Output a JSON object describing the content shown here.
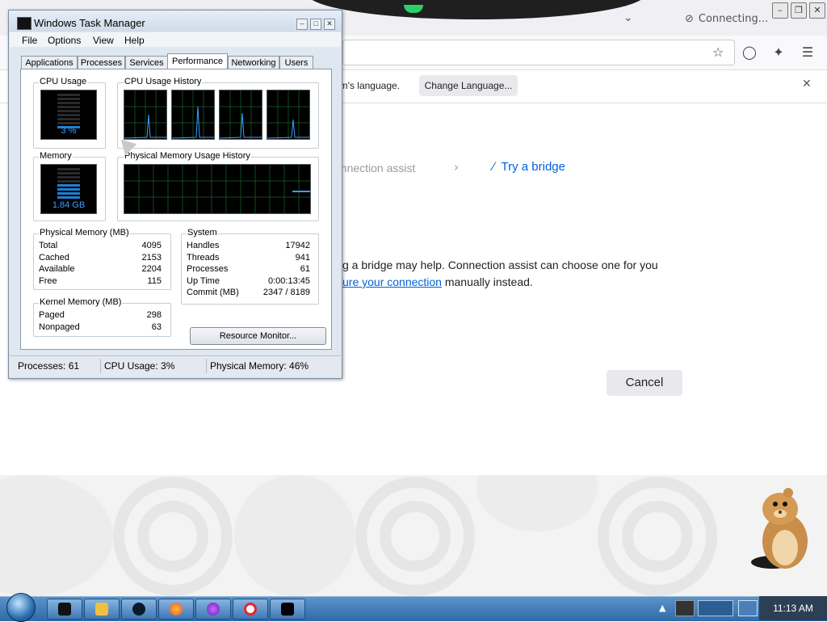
{
  "browser": {
    "status": "Connecting...",
    "language_bar": {
      "message": "em's language.",
      "change_button": "Change Language..."
    },
    "breadcrumb": {
      "connection_assist": "onnection assist",
      "try_bridge": "Try a bridge"
    },
    "body": {
      "line1": "g a bridge may help. Connection assist can choose one for you",
      "line2_link": "ure your connection",
      "line2_rest": " manually instead."
    },
    "cancel_label": "Cancel"
  },
  "task_manager": {
    "title": "Windows Task Manager",
    "menu": [
      "File",
      "Options",
      "View",
      "Help"
    ],
    "tabs": [
      "Applications",
      "Processes",
      "Services",
      "Performance",
      "Networking",
      "Users"
    ],
    "active_tab": "Performance",
    "cpu_usage": {
      "label": "CPU Usage",
      "value": "3 %"
    },
    "cpu_history_label": "CPU Usage History",
    "memory": {
      "label": "Memory",
      "value": "1.84 GB"
    },
    "mem_history_label": "Physical Memory Usage History",
    "physical_memory": {
      "label": "Physical Memory (MB)",
      "rows": [
        {
          "name": "Total",
          "value": "4095"
        },
        {
          "name": "Cached",
          "value": "2153"
        },
        {
          "name": "Available",
          "value": "2204"
        },
        {
          "name": "Free",
          "value": "115"
        }
      ]
    },
    "kernel_memory": {
      "label": "Kernel Memory (MB)",
      "rows": [
        {
          "name": "Paged",
          "value": "298"
        },
        {
          "name": "Nonpaged",
          "value": "63"
        }
      ]
    },
    "system": {
      "label": "System",
      "rows": [
        {
          "name": "Handles",
          "value": "17942"
        },
        {
          "name": "Threads",
          "value": "941"
        },
        {
          "name": "Processes",
          "value": "61"
        },
        {
          "name": "Up Time",
          "value": "0:00:13:45"
        },
        {
          "name": "Commit (MB)",
          "value": "2347 / 8189"
        }
      ]
    },
    "resource_monitor_button": "Resource Monitor...",
    "status_bar": {
      "processes": "Processes: 61",
      "cpu": "CPU Usage: 3%",
      "memory": "Physical Memory: 46%"
    }
  },
  "taskbar": {
    "clock": "11:13 AM",
    "apps": [
      "command-window",
      "media-player",
      "black-orb-app",
      "firefox",
      "tor-browser",
      "opera",
      "task-manager"
    ]
  },
  "colors": {
    "accent_link": "#0060df",
    "meter_green": "#1e7fd0",
    "tor_green": "#2bd06a"
  }
}
